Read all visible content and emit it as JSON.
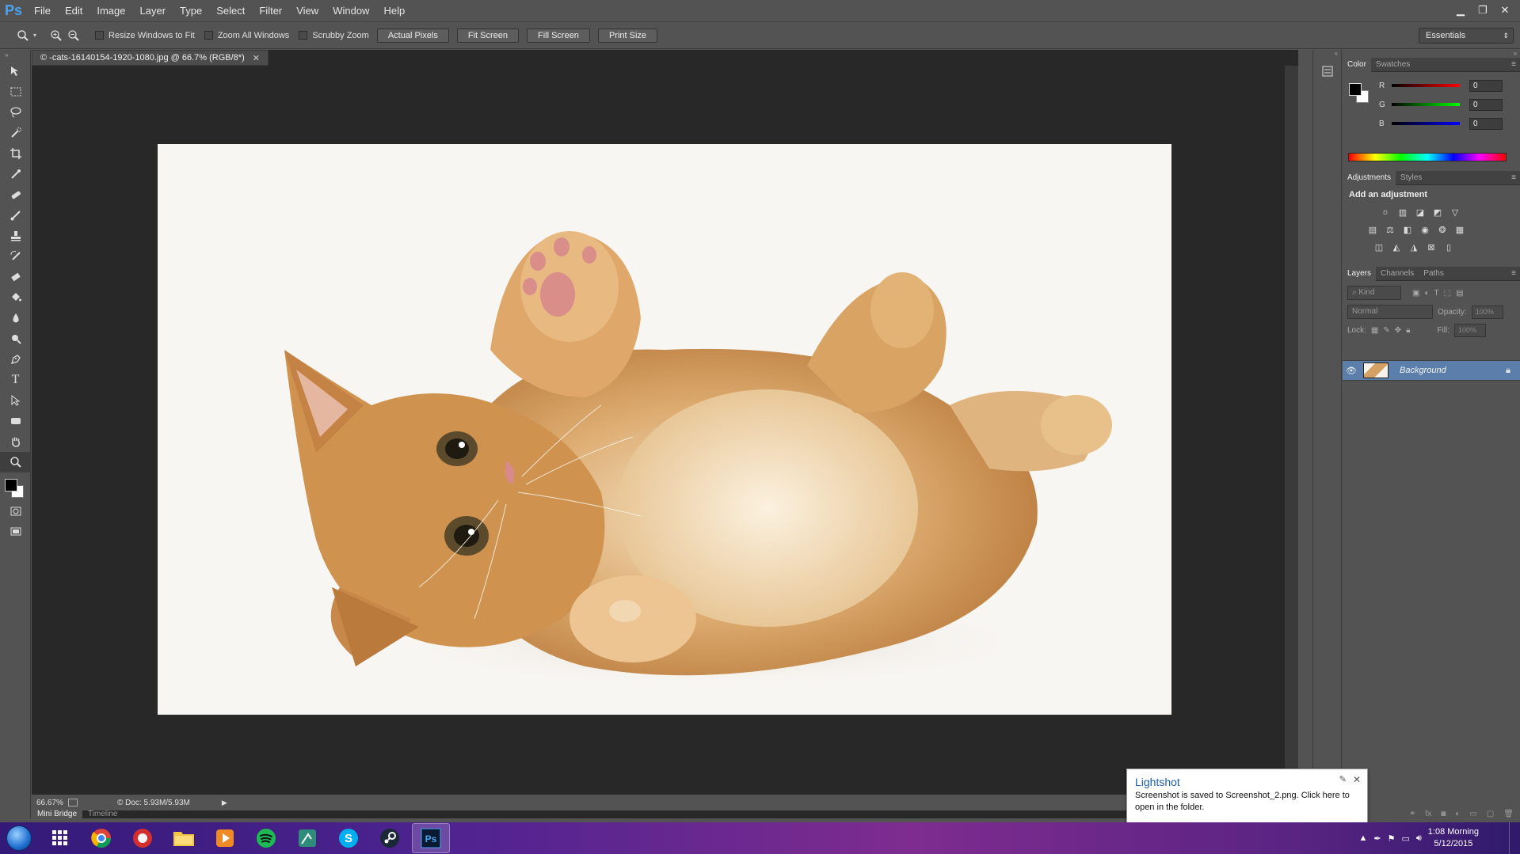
{
  "app": {
    "logo": "Ps",
    "menu": [
      "File",
      "Edit",
      "Image",
      "Layer",
      "Type",
      "Select",
      "Filter",
      "View",
      "Window",
      "Help"
    ],
    "window_controls": [
      "minimize-icon",
      "restore-icon",
      "close-icon"
    ]
  },
  "options": {
    "checks": [
      {
        "label": "Resize Windows to Fit",
        "checked": false
      },
      {
        "label": "Zoom All Windows",
        "checked": false
      },
      {
        "label": "Scrubby Zoom",
        "checked": false
      }
    ],
    "buttons": [
      "Actual Pixels",
      "Fit Screen",
      "Fill Screen",
      "Print Size"
    ],
    "workspace": "Essentials"
  },
  "document": {
    "tab_title": "© -cats-16140154-1920-1080.jpg @ 66.7% (RGB/8*)",
    "zoom": "66.67%",
    "doc_size": "© Doc: 5.93M/5.93M"
  },
  "panels": {
    "color": {
      "tabs": [
        "Color",
        "Swatches"
      ],
      "r_label": "R",
      "r_value": "0",
      "g_label": "G",
      "g_value": "0",
      "b_label": "B",
      "b_value": "0"
    },
    "adjustments": {
      "tabs": [
        "Adjustments",
        "Styles"
      ],
      "title": "Add an adjustment"
    },
    "layers": {
      "tabs": [
        "Layers",
        "Channels",
        "Paths"
      ],
      "kind": "Kind",
      "blend_mode": "Normal",
      "opacity_label": "Opacity:",
      "opacity_value": "100%",
      "lock_label": "Lock:",
      "fill_label": "Fill:",
      "fill_value": "100%",
      "layer_name": "Background"
    }
  },
  "bottom_tabs": [
    "Mini Bridge",
    "Timeline"
  ],
  "toast": {
    "title": "Lightshot",
    "body": "Screenshot is saved to Screenshot_2.png. Click here to open in the folder."
  },
  "taskbar": {
    "time": "1:08 Morning",
    "date": "5/12/2015",
    "apps": [
      "windows-apps-icon",
      "chrome-icon",
      "red-app-icon",
      "file-explorer-icon",
      "media-player-icon",
      "spotify-icon",
      "terminal-icon",
      "skype-icon",
      "steam-icon",
      "photoshop-icon"
    ]
  },
  "colors": {
    "ui_bg": "#535353",
    "canvas_bg": "#282828",
    "accent_blue": "#5b7faa",
    "ps_blue": "#4aa3f0"
  }
}
